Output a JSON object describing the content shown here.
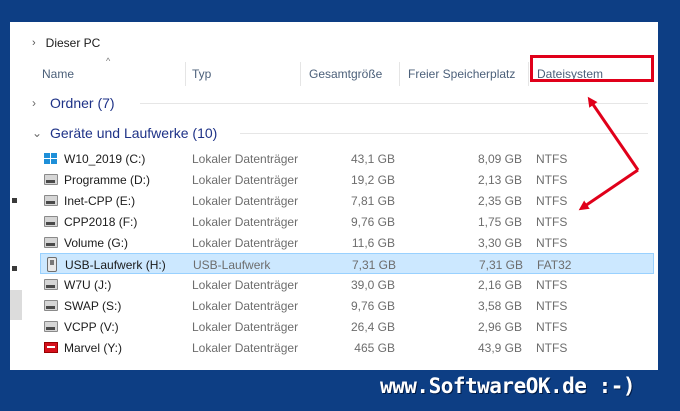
{
  "address": {
    "chevron": "›",
    "location": "Dieser PC"
  },
  "columns": {
    "name": "Name",
    "type": "Typ",
    "total": "Gesamtgröße",
    "free": "Freier Speicherplatz",
    "fs": "Dateisystem",
    "sort_indicator": "^"
  },
  "groups": {
    "folders": {
      "label": "Ordner (7)",
      "expanded": false
    },
    "devices": {
      "label": "Geräte und Laufwerke (10)",
      "expanded": true
    }
  },
  "drives": [
    {
      "name": "W10_2019 (C:)",
      "type": "Lokaler Datenträger",
      "total": "43,1 GB",
      "free": "8,09 GB",
      "fs": "NTFS",
      "icon": "windows-drive-icon"
    },
    {
      "name": "Programme (D:)",
      "type": "Lokaler Datenträger",
      "total": "19,2 GB",
      "free": "2,13 GB",
      "fs": "NTFS",
      "icon": "hard-drive-icon"
    },
    {
      "name": "Inet-CPP (E:)",
      "type": "Lokaler Datenträger",
      "total": "7,81 GB",
      "free": "2,35 GB",
      "fs": "NTFS",
      "icon": "hard-drive-icon"
    },
    {
      "name": "CPP2018 (F:)",
      "type": "Lokaler Datenträger",
      "total": "9,76 GB",
      "free": "1,75 GB",
      "fs": "NTFS",
      "icon": "hard-drive-icon"
    },
    {
      "name": "Volume (G:)",
      "type": "Lokaler Datenträger",
      "total": "11,6 GB",
      "free": "3,30 GB",
      "fs": "NTFS",
      "icon": "hard-drive-icon"
    },
    {
      "name": "USB-Laufwerk (H:)",
      "type": "USB-Laufwerk",
      "total": "7,31 GB",
      "free": "7,31 GB",
      "fs": "FAT32",
      "icon": "usb-drive-icon",
      "selected": true
    },
    {
      "name": "W7U (J:)",
      "type": "Lokaler Datenträger",
      "total": "39,0 GB",
      "free": "2,16 GB",
      "fs": "NTFS",
      "icon": "hard-drive-icon"
    },
    {
      "name": "SWAP (S:)",
      "type": "Lokaler Datenträger",
      "total": "9,76 GB",
      "free": "3,58 GB",
      "fs": "NTFS",
      "icon": "hard-drive-icon"
    },
    {
      "name": "VCPP (V:)",
      "type": "Lokaler Datenträger",
      "total": "26,4 GB",
      "free": "2,96 GB",
      "fs": "NTFS",
      "icon": "hard-drive-icon"
    },
    {
      "name": "Marvel (Y:)",
      "type": "Lokaler Datenträger",
      "total": "465 GB",
      "free": "43,9 GB",
      "fs": "NTFS",
      "icon": "marvel-drive-icon"
    }
  ],
  "colors": {
    "highlight": "#e0001a",
    "selection": "#cce8ff",
    "background": "#0d3e84"
  },
  "branding": {
    "text": "www.SoftwareOK.de :-)"
  }
}
